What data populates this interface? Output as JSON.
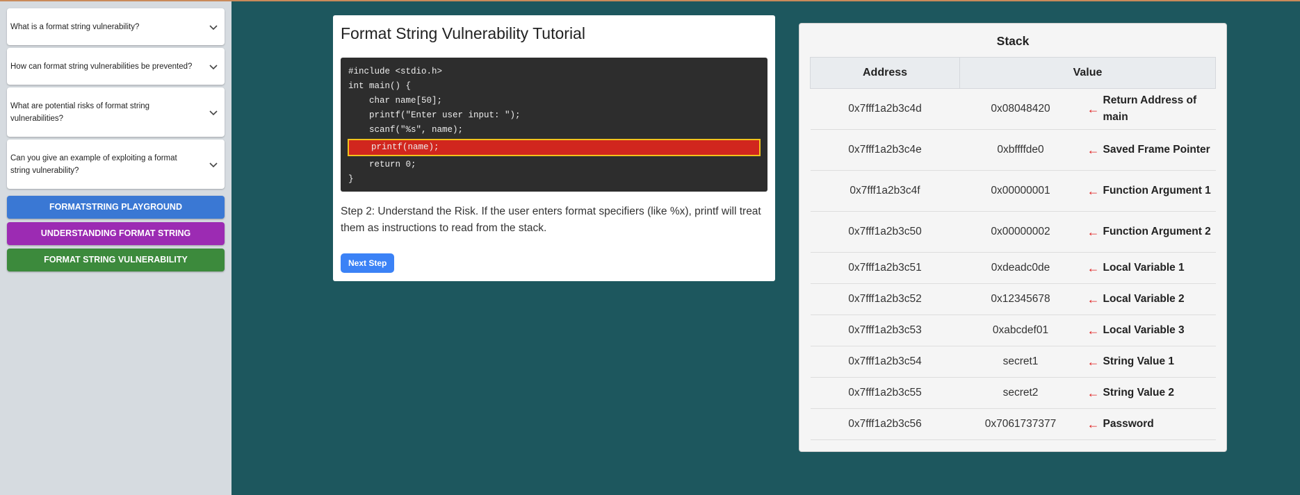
{
  "sidebar": {
    "faqs": [
      {
        "question": "What is a format string vulnerability?"
      },
      {
        "question": "How can format string vulnerabilities be prevented?"
      },
      {
        "question": "What are potential risks of format string vulnerabilities?"
      },
      {
        "question": "Can you give an example of exploiting a format string vulnerability?"
      }
    ],
    "buttons": [
      {
        "label": "FORMATSTRING PLAYGROUND",
        "color": "#3a78d4"
      },
      {
        "label": "UNDERSTANDING FORMAT STRING",
        "color": "#9c2bb3"
      },
      {
        "label": "FORMAT STRING VULNERABILITY",
        "color": "#3c8a3c"
      }
    ]
  },
  "tutorial": {
    "title": "Format String Vulnerability Tutorial",
    "code_lines": [
      "#include <stdio.h>",
      "int main() {",
      "    char name[50];",
      "    printf(\"Enter user input: \");",
      "    scanf(\"%s\", name);",
      "    printf(name);",
      "    return 0;",
      "}"
    ],
    "highlighted_line_index": 5,
    "step_text": "Step 2: Understand the Risk. If the user enters format specifiers (like %x), printf will treat them as instructions to read from the stack.",
    "next_button": "Next Step"
  },
  "stack": {
    "title": "Stack",
    "headers": {
      "address": "Address",
      "value": "Value"
    },
    "arrow": "←",
    "rows": [
      {
        "address": "0x7fff1a2b3c4d",
        "value": "0x08048420",
        "label": "Return Address of main"
      },
      {
        "address": "0x7fff1a2b3c4e",
        "value": "0xbffffde0",
        "label": "Saved Frame Pointer"
      },
      {
        "address": "0x7fff1a2b3c4f",
        "value": "0x00000001",
        "label": "Function Argument 1"
      },
      {
        "address": "0x7fff1a2b3c50",
        "value": "0x00000002",
        "label": "Function Argument 2"
      },
      {
        "address": "0x7fff1a2b3c51",
        "value": "0xdeadc0de",
        "label": "Local Variable 1"
      },
      {
        "address": "0x7fff1a2b3c52",
        "value": "0x12345678",
        "label": "Local Variable 2"
      },
      {
        "address": "0x7fff1a2b3c53",
        "value": "0xabcdef01",
        "label": "Local Variable 3"
      },
      {
        "address": "0x7fff1a2b3c54",
        "value": "secret1",
        "label": "String Value 1"
      },
      {
        "address": "0x7fff1a2b3c55",
        "value": "secret2",
        "label": "String Value 2"
      },
      {
        "address": "0x7fff1a2b3c56",
        "value": "0x7061737377",
        "label": "Password"
      }
    ]
  }
}
